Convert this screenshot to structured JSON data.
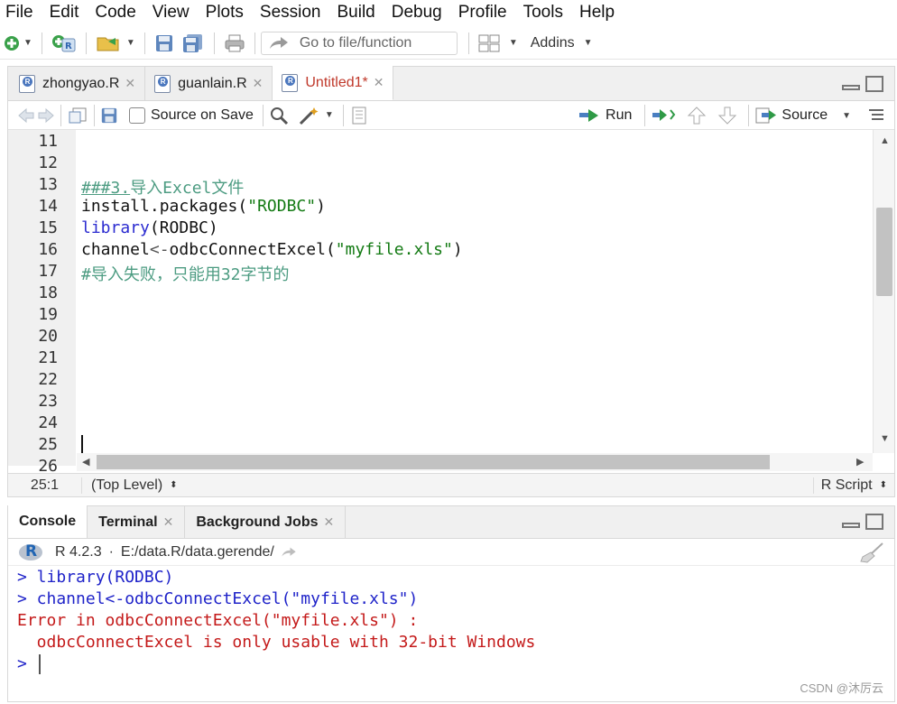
{
  "menu": [
    "File",
    "Edit",
    "Code",
    "View",
    "Plots",
    "Session",
    "Build",
    "Debug",
    "Profile",
    "Tools",
    "Help"
  ],
  "toolbar": {
    "goto_placeholder": "Go to file/function",
    "addins_label": "Addins"
  },
  "editor": {
    "tabs": [
      {
        "label": "zhongyao.R",
        "active": false
      },
      {
        "label": "guanlain.R",
        "active": false
      },
      {
        "label": "Untitled1*",
        "active": true
      }
    ],
    "source_on_save_label": "Source on Save",
    "run_label": "Run",
    "source_label": "Source",
    "line_numbers": [
      "11",
      "12",
      "13",
      "14",
      "15",
      "16",
      "17",
      "18",
      "19",
      "20",
      "21",
      "22",
      "23",
      "24",
      "25",
      "26"
    ],
    "code": {
      "line13_prefix": "###3.",
      "line13_rest": "导入Excel文件",
      "line14_fn": "install.packages(",
      "line14_str": "\"RODBC\"",
      "line14_end": ")",
      "line15_kw": "library",
      "line15_rest": "(RODBC)",
      "line16_a": "channel",
      "line16_op": "<-",
      "line16_fn": "odbcConnectExcel(",
      "line16_str": "\"myfile.xls\"",
      "line16_end": ")",
      "line17": "#导入失败，只能用32字节的"
    },
    "status": {
      "position": "25:1",
      "scope": "(Top Level)",
      "filetype": "R Script"
    }
  },
  "console": {
    "tabs": [
      {
        "label": "Console",
        "active": true
      },
      {
        "label": "Terminal",
        "active": false
      },
      {
        "label": "Background Jobs",
        "active": false
      }
    ],
    "r_version": "R 4.2.3",
    "dot": "·",
    "working_dir": "E:/data.R/data.gerende/",
    "lines": [
      {
        "text": "> library(RODBC)",
        "color": "blue"
      },
      {
        "text": "> channel<-odbcConnectExcel(\"myfile.xls\")",
        "color": "blue"
      },
      {
        "text": "Error in odbcConnectExcel(\"myfile.xls\") : ",
        "color": "red"
      },
      {
        "text": "  odbcConnectExcel is only usable with 32-bit Windows",
        "color": "red"
      }
    ],
    "prompt": ">"
  },
  "watermark": "CSDN @沐厉云",
  "colors": {
    "comment": "#4d9c82",
    "keyword": "#2b2bd0",
    "string": "#137a13",
    "console_input": "#1f23c9",
    "console_error": "#c41a1a",
    "active_tab_text": "#c0392b"
  }
}
